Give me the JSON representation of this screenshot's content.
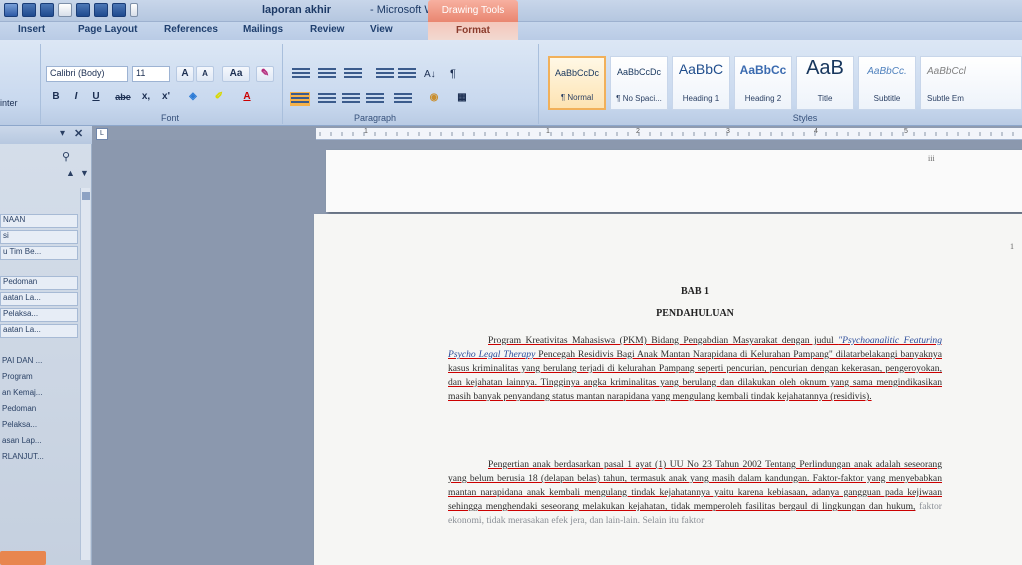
{
  "window": {
    "title_doc": "laporan akhir",
    "title_app": "- Microsoft Word",
    "contextual_tab_group": "Drawing Tools"
  },
  "tabs": [
    "Insert",
    "Page Layout",
    "References",
    "Mailings",
    "Review",
    "View"
  ],
  "contextual_tab": "Format",
  "ribbon": {
    "clipboard_label": "inter",
    "font": {
      "name": "Calibri (Body)",
      "size": "11",
      "grow": "A",
      "shrink": "A",
      "change_case": "Aa",
      "bold": "B",
      "italic": "I",
      "underline": "U",
      "strike": "abe",
      "subscript": "x,",
      "superscript": "x'",
      "color_a": "A",
      "group_label": "Font"
    },
    "paragraph": {
      "pilcrow": "¶",
      "sort": "A↓",
      "group_label": "Paragraph"
    },
    "styles": {
      "group_label": "Styles",
      "items": [
        {
          "sample": "AaBbCcDc",
          "name": "¶ Normal"
        },
        {
          "sample": "AaBbCcDc",
          "name": "¶ No Spaci..."
        },
        {
          "sample": "AaBbC",
          "name": "Heading 1"
        },
        {
          "sample": "AaBbCc",
          "name": "Heading 2"
        },
        {
          "sample": "AaB",
          "name": "Title"
        },
        {
          "sample": "AaBbCc.",
          "name": "Subtitle"
        },
        {
          "sample": "AaBbCcl",
          "name": "Subtle Em"
        }
      ]
    }
  },
  "navpane": {
    "items": [
      "NAAN",
      "si",
      "u Tim Be...",
      "Pedoman",
      "aatan La...",
      "Pelaksa...",
      "aatan La...",
      "PAI DAN ...",
      "Program",
      "an Kemaj...",
      "Pedoman",
      "Pelaksa...",
      "asan Lap...",
      "RLANJUT..."
    ]
  },
  "ruler": {
    "numbers": [
      "1",
      "1",
      "2",
      "3",
      "4",
      "5"
    ]
  },
  "document": {
    "page1_mark": "iii",
    "page2_number": "1",
    "chapter": "BAB 1",
    "chapter_title": "PENDAHULUAN",
    "para1": {
      "part1": "Program Kreativitas Mahasiswa (PKM) Bidang Pengabdian Masyarakat dengan judul ",
      "title": "\"Psychoanalitic Featuring Psycho Legal Therapy",
      "part2": " Pencegah Residivis Bagi Anak Mantan Narapidana di Kelurahan Pampang\" dilatarbelakangi banyaknya kasus kriminalitas yang berulang terjadi di kelurahan Pampang seperti pencurian, pencurian dengan kekerasan, pengeroyokan, dan kejahatan lainnya. Tingginya angka kriminalitas yang berulang dan dilakukan oleh oknum yang sama mengindikasikan masih banyak penyandang status mantan narapidana yang mengulang kembali tindak kejahatannya (residivis)."
    },
    "para2": {
      "part1": "Pengertian anak berdasarkan pasal 1 ayat (1) UU No 23 Tahun 2002 Tentang Perlindungan anak adalah seseorang yang belum berusia 18 (delapan belas) tahun, termasuk anak yang masih dalam kandungan. Faktor-faktor yang menyebabkan mantan narapidana anak kembali mengulang tindak kejahatannya yaitu karena kebiasaan, adanya gangguan pada kejiwaan sehingga menghendaki seseorang melakukan kejahatan, tidak memperoleh fasilitas bergaul di lingkungan dan hukum,",
      "part2": " faktor ekonomi, tidak merasakan efek jera, dan lain-lain. Selain itu faktor"
    }
  }
}
